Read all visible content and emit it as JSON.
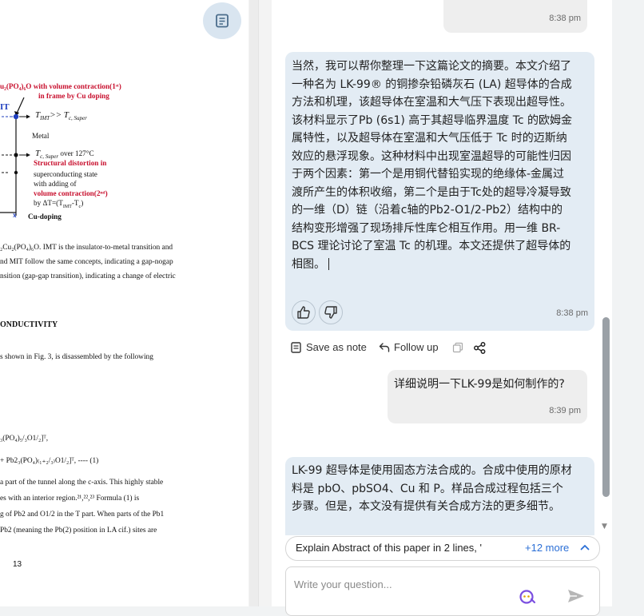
{
  "pdf": {
    "figure": {
      "title_line1": "u₂(PO₄)₆O with volume contraction(1ˢᵗ)",
      "title_line2": "in frame by Cu doping",
      "mit_label": "IT",
      "t_imt": "T",
      "t_imt_sub": "IMT",
      "t_imt_rest": ">> T",
      "t_imt_rest_sub": "c, Super",
      "metal": "Metal",
      "tc_super": "T",
      "tc_super_sub": "c, Super",
      "tc_super_rest": " over 127°C",
      "structural": "Structural distortion in",
      "sc_state": "superconducting state",
      "with_adding": "with adding of",
      "vol_contraction": "volume contraction(2ⁿᵈ)",
      "by_dt": "by ΔT=(T",
      "by_dt_sub": "IMT",
      "by_dt_rest": "-T",
      "by_dt_sub2": "c",
      "by_dt_close": ")",
      "x_label": "x",
      "cu_doping": "Cu-doping"
    },
    "caption": [
      "₂Cu₂(PO₄)₆O. IMT is the insulator-to-metal transition and",
      "nd MIT follow the same concepts, indicating a gap-nogap",
      "nsition (gap-gap transition), indicating a change of electric"
    ],
    "heading": "ONDUCTIVITY",
    "para1": "s shown in Fig. 3, is disassembled by the following",
    "formula1": "₃(PO₄)₅/₃O1/₂]ᵀ,",
    "formula2": "+ Pb2₃(PO₄)₍₁₊₂/₃₎O1/₂]ᵀ, ---- (1)",
    "para2": [
      "a part of the tunnel along the c-axis. This highly stable",
      "es with an interior region.²¹,²²,²³ Formula (1) is",
      "g of Pb2 and O1/2 in the T part. When parts of the Pb1",
      "Pb2 (meaning the Pb(2) position in LA cif.) sites are"
    ],
    "page_number": "13"
  },
  "chat": {
    "messages": [
      {
        "role": "user",
        "text": "",
        "time": "8:38 pm"
      },
      {
        "role": "assistant",
        "text": "当然，我可以帮你整理一下这篇论文的摘要。本文介绍了一种名为 LK-99® 的铜掺杂铅磷灰石 (LA) 超导体的合成方法和机理，该超导体在室温和大气压下表现出超导性。该材料显示了Pb (6s1) 高于其超导临界温度 Tc 的欧姆金属特性，以及超导体在室温和大气压低于 Tc 时的迈斯纳效应的悬浮现象。这种材料中出现室温超导的可能性归因于两个因素：第一个是用铜代替铅实现的绝缘体-金属过渡所产生的体积收缩，第二个是由于Tc处的超导冷凝导致的一维（D）链（沿着c轴的Pb2-O1/2-Pb2）结构中的结构变形增强了现场排斥性库仑相互作用。用一维 BR-BCS 理论讨论了室温 Tc 的机理。本文还提供了超导体的相图。",
        "time": "8:38 pm"
      },
      {
        "role": "user",
        "text": "详细说明一下LK-99是如何制作的?",
        "time": "8:39 pm"
      },
      {
        "role": "assistant",
        "text": "LK-99 超导体是使用固态方法合成的。合成中使用的原材料是 pbO、pbSO4、Cu 和 P。样品合成过程包括三个步骤。但是，本文没有提供有关合成方法的更多细节。",
        "time": ""
      }
    ],
    "actions": {
      "save_note": "Save as note",
      "follow_up": "Follow up"
    },
    "suggestion": {
      "text": "Explain Abstract of this paper in 2 lines, '",
      "more": "+12 more"
    },
    "input": {
      "placeholder": "Write your question..."
    }
  }
}
